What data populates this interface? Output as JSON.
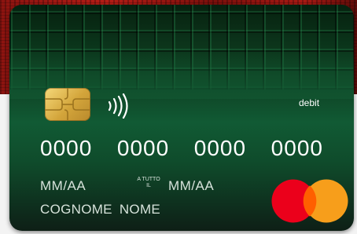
{
  "card": {
    "type_label": "debit",
    "number_groups": [
      "0000",
      "0000",
      "0000",
      "0000"
    ],
    "expiry": "MM/AA",
    "valid_thru_label_line1": "A TUTTO",
    "valid_thru_label_line2": "IL",
    "valid_thru_value": "MM/AA",
    "holder_name": "COGNOME NOME",
    "network": "mastercard-logo-icon",
    "colors": {
      "card_top": "#0b2715",
      "card_mid": "#115a34",
      "backdrop": "#b51d16",
      "mastercard_red": "#eb001b",
      "mastercard_yellow": "#f79e1b",
      "mastercard_overlap": "#ff5f00"
    }
  }
}
